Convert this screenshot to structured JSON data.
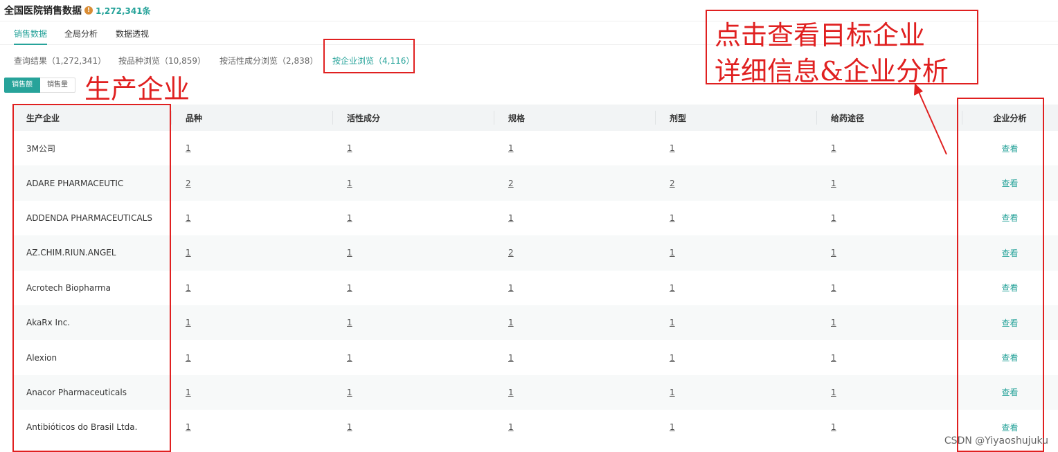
{
  "header": {
    "title": "全国医院销售数据",
    "info_icon": "!",
    "count": "1,272,341条"
  },
  "main_tabs": [
    "销售数据",
    "全局分析",
    "数据透视"
  ],
  "sub_tabs": [
    "查询结果（1,272,341）",
    "按品种浏览（10,859）",
    "按活性成分浏览（2,838）",
    "按企业浏览（4,116）"
  ],
  "toggle": [
    "销售额",
    "销售量"
  ],
  "table": {
    "columns": [
      "生产企业",
      "品种",
      "活性成分",
      "规格",
      "剂型",
      "给药途径",
      "企业分析"
    ],
    "action_label": "查看",
    "rows": [
      {
        "company": "3M公司",
        "c1": "1",
        "c2": "1",
        "c3": "1",
        "c4": "1",
        "c5": "1"
      },
      {
        "company": "ADARE PHARMACEUTIC",
        "c1": "2",
        "c2": "1",
        "c3": "2",
        "c4": "2",
        "c5": "1"
      },
      {
        "company": "ADDENDA PHARMACEUTICALS",
        "c1": "1",
        "c2": "1",
        "c3": "1",
        "c4": "1",
        "c5": "1"
      },
      {
        "company": "AZ.CHIM.RIUN.ANGEL",
        "c1": "1",
        "c2": "1",
        "c3": "2",
        "c4": "1",
        "c5": "1"
      },
      {
        "company": "Acrotech Biopharma",
        "c1": "1",
        "c2": "1",
        "c3": "1",
        "c4": "1",
        "c5": "1"
      },
      {
        "company": "AkaRx Inc.",
        "c1": "1",
        "c2": "1",
        "c3": "1",
        "c4": "1",
        "c5": "1"
      },
      {
        "company": "Alexion",
        "c1": "1",
        "c2": "1",
        "c3": "1",
        "c4": "1",
        "c5": "1"
      },
      {
        "company": "Anacor Pharmaceuticals",
        "c1": "1",
        "c2": "1",
        "c3": "1",
        "c4": "1",
        "c5": "1"
      },
      {
        "company": "Antibióticos do Brasil Ltda.",
        "c1": "1",
        "c2": "1",
        "c3": "1",
        "c4": "1",
        "c5": "1"
      }
    ]
  },
  "annotations": {
    "left_label": "生产企业",
    "right_line1": "点击查看目标企业",
    "right_line2": "详细信息&企业分析",
    "color": "#e02020"
  },
  "watermark": "CSDN @Yiyaoshujuku",
  "colors": {
    "accent": "#27a39a",
    "info": "#d98c34"
  }
}
